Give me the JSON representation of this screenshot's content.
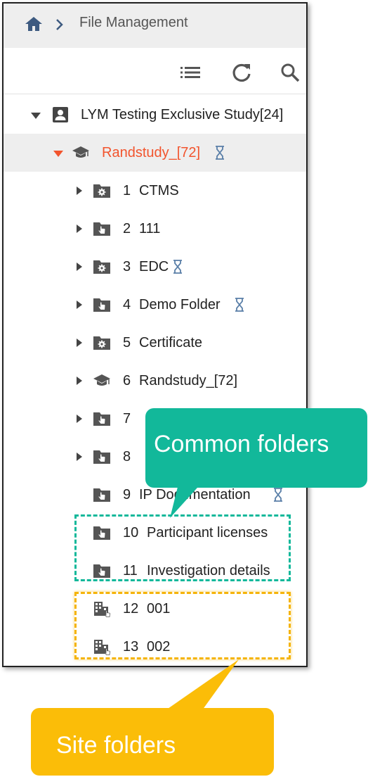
{
  "breadcrumb": {
    "home_icon": "home-icon",
    "separator_icon": "chevron-right-icon",
    "title": "File Management"
  },
  "toolbar": {
    "icons": [
      "list-icon",
      "refresh-icon",
      "search-icon"
    ]
  },
  "tree": {
    "root": {
      "label": "LYM Testing Exclusive Study[24]",
      "icon": "person-folder-icon",
      "expanded": true
    },
    "study": {
      "label": "Randstudy_[72]",
      "icon": "graduation-cap-icon",
      "expanded": true,
      "selected": true,
      "pending": true
    },
    "folders": [
      {
        "number": "1",
        "name": "CTMS",
        "icon": "gear-folder-icon",
        "expandable": true,
        "pending": false
      },
      {
        "number": "2",
        "name": "111",
        "icon": "hand-folder-icon",
        "expandable": true,
        "pending": false
      },
      {
        "number": "3",
        "name": "EDC",
        "icon": "gear-folder-icon",
        "expandable": true,
        "pending": true
      },
      {
        "number": "4",
        "name": "Demo Folder",
        "icon": "hand-folder-icon",
        "expandable": true,
        "pending": true
      },
      {
        "number": "5",
        "name": "Certificate",
        "icon": "gear-folder-icon",
        "expandable": true,
        "pending": false
      },
      {
        "number": "6",
        "name": "Randstudy_[72]",
        "icon": "graduation-cap-icon",
        "expandable": true,
        "pending": false
      },
      {
        "number": "7",
        "name": "",
        "icon": "hand-folder-icon",
        "expandable": true,
        "pending": false
      },
      {
        "number": "8",
        "name": "",
        "icon": "hand-folder-icon",
        "expandable": true,
        "pending": false
      },
      {
        "number": "9",
        "name": "IP Documentation",
        "icon": "hand-folder-icon",
        "expandable": false,
        "pending": true
      },
      {
        "number": "10",
        "name": "Participant licenses",
        "icon": "hand-folder-icon",
        "expandable": false,
        "pending": false
      },
      {
        "number": "11",
        "name": "Investigation details",
        "icon": "hand-folder-icon",
        "expandable": false,
        "pending": false
      },
      {
        "number": "12",
        "name": "001",
        "icon": "building-icon",
        "expandable": false,
        "pending": false
      },
      {
        "number": "13",
        "name": "002",
        "icon": "building-icon",
        "expandable": false,
        "pending": false
      }
    ]
  },
  "callouts": {
    "common": "Common folders",
    "site": "Site folders"
  },
  "colors": {
    "accent_selected": "#f2542d",
    "callout_common": "#12b89a",
    "callout_site": "#fbbd08",
    "pending_icon": "#5a7fa8"
  }
}
